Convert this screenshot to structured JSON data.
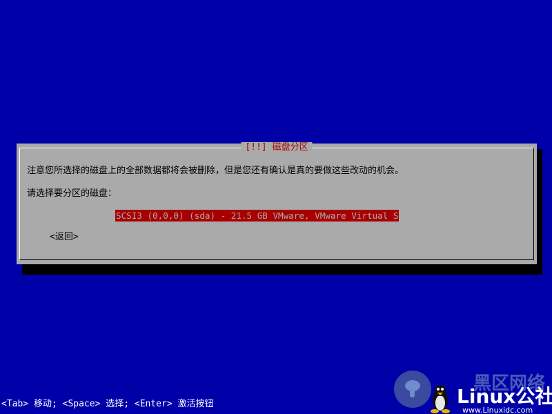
{
  "dialog": {
    "title_brackets": "[!!]",
    "title": "磁盘分区",
    "message": "注意您所选择的磁盘上的全部数据都将会被删除，但是您还有确认是真的要做这些改动的机会。",
    "prompt": "请选择要分区的磁盘：",
    "disk_option": "SCSI3 (0,0,0) (sda) - 21.5 GB VMware, VMware Virtual S",
    "back_button": "<返回>"
  },
  "footer": {
    "help": "<Tab> 移动; <Space> 选择; <Enter> 激活按钮"
  },
  "watermark": {
    "top_text": "黑区网络",
    "brand": "Linux公社",
    "url": "www.Linuxidc.com"
  },
  "colors": {
    "background": "#0000a8",
    "dialog": "#aaaaaa",
    "title": "#a80000",
    "selection": "#a80000"
  }
}
